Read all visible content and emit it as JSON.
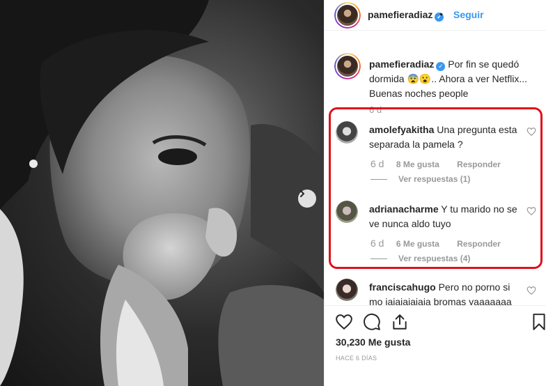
{
  "post": {
    "username": "pamefieradiaz",
    "follow_label": "Seguir",
    "dot": "•",
    "caption_text": "Por fin se quedó dormida 😨😮.. Ahora a ver Netflix... Buenas noches people",
    "caption_time": "6 d",
    "likes": "30,230 Me gusta",
    "posted_ago": "HACE 6 DÍAS"
  },
  "comments": [
    {
      "username": "amolefyakitha",
      "text": "Una pregunta esta separada la pamela ?",
      "time": "6 d",
      "likes": "8 Me gusta",
      "reply": "Responder",
      "view_replies": "Ver respuestas (1)"
    },
    {
      "username": "adrianacharme",
      "text": "Y tu marido no se ve nunca aldo tuyo",
      "time": "6 d",
      "likes": "6 Me gusta",
      "reply": "Responder",
      "view_replies": "Ver respuestas (4)"
    },
    {
      "username": "franciscahugo",
      "text": "Pero no porno si mo jajajajajaja bromas yaaaaaaa"
    }
  ],
  "icons": {
    "verified": "verified-badge-icon",
    "next": "chevron-right-icon",
    "heart": "heart-icon",
    "comment": "comment-icon",
    "share": "share-icon",
    "save": "bookmark-icon"
  },
  "colors": {
    "accent": "#3897f0",
    "highlight": "#e0101a",
    "muted": "#999999",
    "text": "#262626"
  }
}
